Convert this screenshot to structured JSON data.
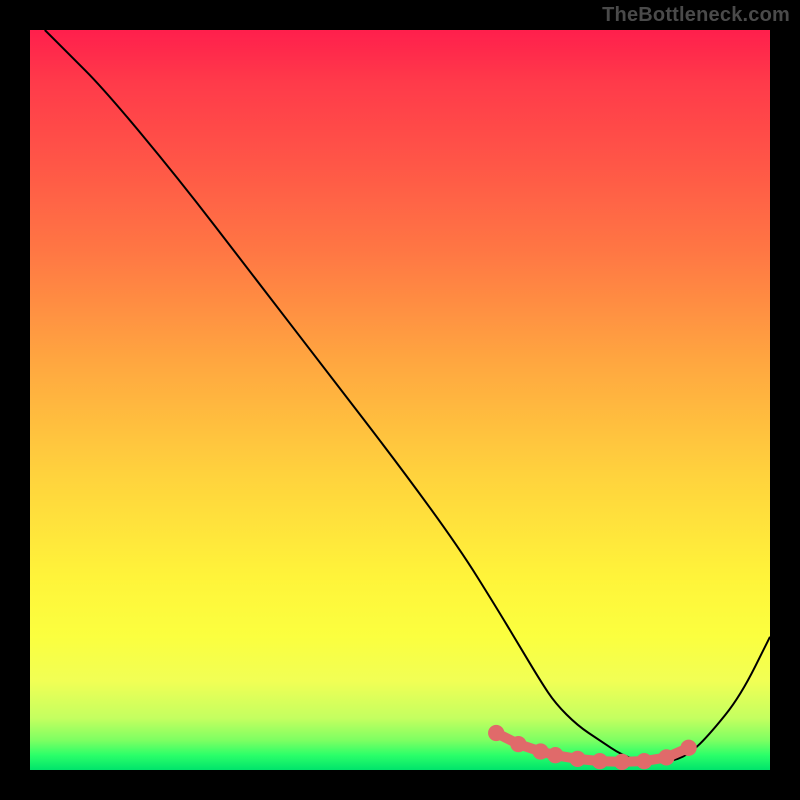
{
  "watermark": "TheBottleneck.com",
  "chart_data": {
    "type": "line",
    "title": "",
    "xlabel": "",
    "ylabel": "",
    "xlim": [
      0,
      100
    ],
    "ylim": [
      0,
      100
    ],
    "grid": false,
    "legend": false,
    "series": [
      {
        "name": "curve",
        "x": [
          2,
          5,
          10,
          20,
          30,
          40,
          50,
          58,
          63,
          66,
          69,
          71,
          74,
          77,
          80,
          83,
          86,
          89,
          92,
          96,
          100
        ],
        "values": [
          100,
          97,
          92,
          80,
          67,
          54,
          41,
          30,
          22,
          17,
          12,
          9,
          6,
          4,
          2,
          1,
          1,
          2,
          5,
          10,
          18
        ]
      }
    ],
    "highlight_segment": {
      "x": [
        63,
        66,
        69,
        71,
        74,
        77,
        80,
        83,
        86,
        89
      ],
      "values": [
        5,
        3.5,
        2.5,
        2,
        1.5,
        1.2,
        1.1,
        1.2,
        1.7,
        3
      ]
    }
  }
}
